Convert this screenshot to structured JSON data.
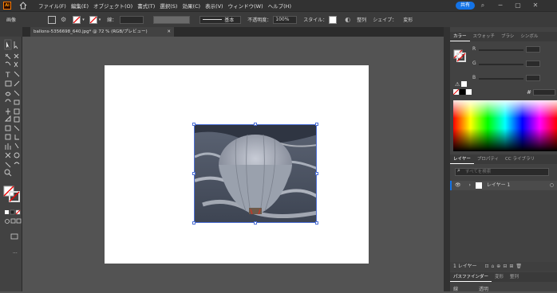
{
  "app": {
    "logo_text": "Ai",
    "menu": [
      "ファイル(F)",
      "編集(E)",
      "オブジェクト(O)",
      "書式(T)",
      "選択(S)",
      "効果(C)",
      "表示(V)",
      "ウィンドウ(W)",
      "ヘルプ(H)"
    ],
    "share_label": "共有"
  },
  "control_bar": {
    "object_label": "画像",
    "stroke_label": "線：",
    "stroke_style": "基本",
    "opacity_label": "不透明度：",
    "opacity_value": "100%",
    "style_label": "スタイル：",
    "align_label": "整列",
    "shape_label": "シェイプ：",
    "transform_label": "変形"
  },
  "document": {
    "tab_title": "ballons-5356698_640.jpg* @ 72 % (RGB/プレビュー)"
  },
  "color_panel": {
    "tabs": [
      "カラー",
      "スウォッチ",
      "ブラシ",
      "シンボル"
    ],
    "channels": [
      "R",
      "G",
      "B"
    ]
  },
  "layers_panel": {
    "tabs": [
      "レイヤー",
      "プロパティ",
      "CC ライブラリ"
    ],
    "search_placeholder": "すべてを検索",
    "layer_name": "レイヤー 1",
    "footer_label": "1 レイヤー"
  },
  "bottom_panel": {
    "tabs": [
      "パスファインダー",
      "変形",
      "整列"
    ],
    "sub_label": "透明",
    "sub_label2": "線"
  }
}
